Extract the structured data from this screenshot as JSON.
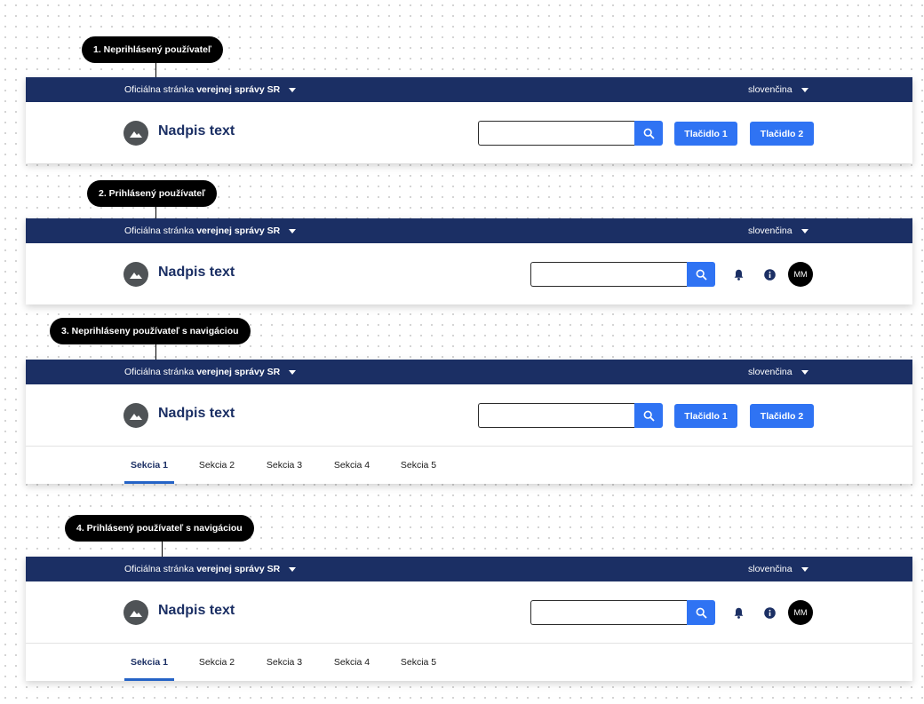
{
  "variants": [
    {
      "label": "1. Neprihlásený používateľ"
    },
    {
      "label": "2. Prihlásený používateľ"
    },
    {
      "label": "3. Neprihláseny používateľ s navigáciou"
    },
    {
      "label": "4. Prihlásený používateľ s navigáciou"
    }
  ],
  "header": {
    "official_prefix": "Oficiálna stránka",
    "official_bold": "verejnej správy SR",
    "language": "slovenčina",
    "site_title": "Nadpis text",
    "search_value": "",
    "button1": "Tlačidlo 1",
    "button2": "Tlačidlo 2",
    "avatar_initials": "MM"
  },
  "nav": {
    "items": [
      "Sekcia 1",
      "Sekcia 2",
      "Sekcia 3",
      "Sekcia 4",
      "Sekcia 5"
    ],
    "active_index": 0
  },
  "icons": {
    "logo": "mountain-icon",
    "dropdown": "caret-down-icon",
    "search": "search-icon",
    "notification": "bell-icon",
    "info": "info-icon"
  },
  "colors": {
    "topbar": "#1b2f64",
    "primary": "#2f73f3",
    "title": "#1b2f64",
    "logo_bg": "#4f5356",
    "nav_underline": "#2563c6"
  }
}
